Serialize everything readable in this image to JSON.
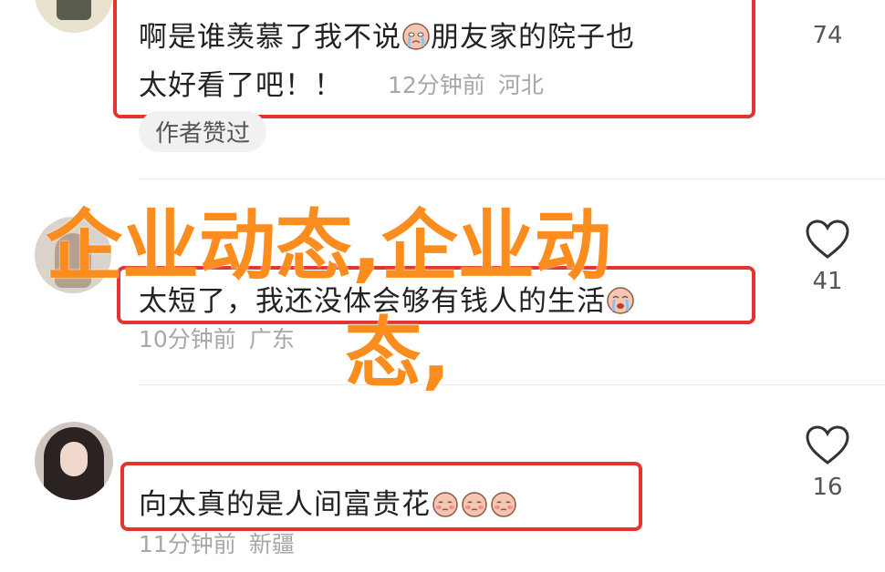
{
  "comments": [
    {
      "text_line1": "啊是谁羡慕了我不说",
      "text_line1_after_emoji": "朋友家的院子也",
      "text_line2": "太好看了吧！！",
      "time": "12分钟前",
      "location": "河北",
      "likes": "74",
      "badge": "作者赞过",
      "emoji": "crying-emoji"
    },
    {
      "text": "太短了，我还没体会够有钱人的生活",
      "time": "10分钟前",
      "location": "广东",
      "likes": "41",
      "emoji": "crying-emoji"
    },
    {
      "text": "向太真的是人间富贵花",
      "time": "11分钟前",
      "location": "新疆",
      "likes": "16",
      "emoji": "shy-emoji"
    }
  ],
  "watermark": {
    "line1": "企业动态,企业动",
    "line2": "态,"
  },
  "colors": {
    "highlight": "#e3342f",
    "watermark": "#fb8c1e",
    "meta": "#a7a7a7"
  },
  "icons": {
    "like": "heart-outline-icon"
  }
}
